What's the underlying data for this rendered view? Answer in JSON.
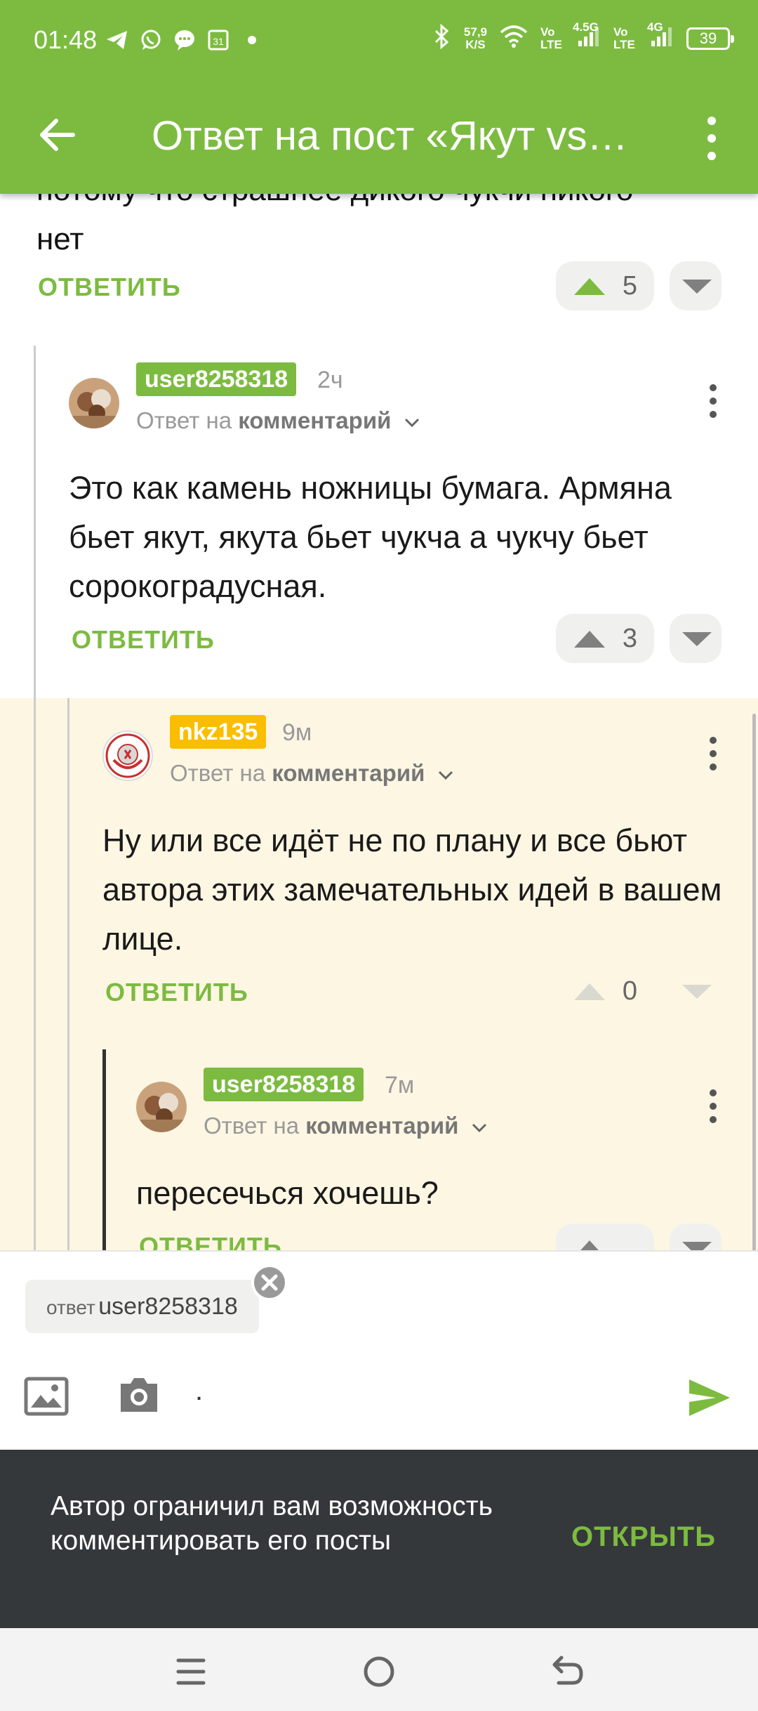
{
  "status_bar": {
    "time": "01:48",
    "net_speed_value": "57,9",
    "net_speed_unit": "K/S",
    "volte1": "Vo LTE",
    "net1": "4.5G",
    "volte2": "Vo LTE",
    "net2": "4G",
    "battery": "39",
    "left_icons": [
      "telegram-icon",
      "whatsapp-icon",
      "message-icon",
      "calendar-icon",
      "dot-icon"
    ],
    "right_icons": [
      "bluetooth-icon",
      "wifi-icon",
      "signal-icon",
      "signal-icon",
      "battery-icon"
    ]
  },
  "app_bar": {
    "title": "Ответ на пост «Якут vs…",
    "back_icon": "arrow-left-icon",
    "menu_icon": "more-vertical-icon",
    "color": "#7cbb40"
  },
  "comments": [
    {
      "text": "нет",
      "cut_text": "потому что страшнее дикого чукчи никого",
      "reply_label": "ОТВЕТИТЬ",
      "score": "5"
    },
    {
      "username": "user8258318",
      "time_ago": "2ч",
      "reply_prefix": "Ответ на",
      "reply_target": "комментарий",
      "text": "Это как камень ножницы бумага. Армяна бьет якут, якута бьет чукча а чукчу бьет сорокоградусная.",
      "reply_label": "ОТВЕТИТЬ",
      "score": "3"
    },
    {
      "username": "nkz135",
      "time_ago": "9м",
      "reply_prefix": "Ответ на",
      "reply_target": "комментарий",
      "text": "Ну или все идёт не по плану и все бьют автора этих замечательных идей в вашем лице.",
      "reply_label": "ОТВЕТИТЬ",
      "score": "0"
    },
    {
      "username": "user8258318",
      "time_ago": "7м",
      "reply_prefix": "Ответ на",
      "reply_target": "комментарий",
      "text": "пересечься хочешь?",
      "reply_label": "ОТВЕТИТЬ"
    }
  ],
  "composer": {
    "reply_chip_label": "ответ",
    "reply_chip_user": "user8258318",
    "input_value": ".",
    "icons": [
      "image-icon",
      "camera-icon",
      "send-icon",
      "close-icon"
    ]
  },
  "banner": {
    "message": "Автор ограничил вам возможность комментировать его посты",
    "action": "ОТКРЫТЬ"
  },
  "nav_bar": {
    "icons": [
      "menu-icon",
      "home-icon",
      "back-icon"
    ]
  },
  "colors": {
    "accent": "#7cbb40",
    "highlight_bg": "#fdf6e3",
    "nick_yellow": "#fbbd00",
    "banner_bg": "#35383b"
  }
}
